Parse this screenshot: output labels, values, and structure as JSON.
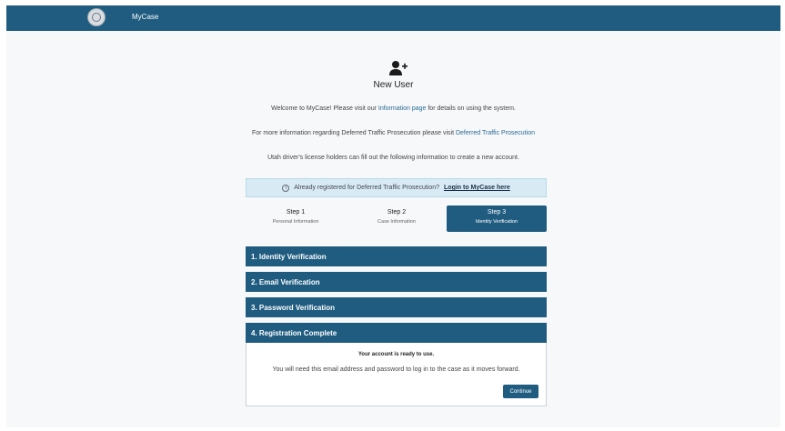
{
  "header": {
    "app_name": "MyCase",
    "seal_icon": "state-seal-icon"
  },
  "page": {
    "icon": "add-user-icon",
    "title": "New User",
    "welcome": {
      "before": "Welcome to MyCase! Please visit our ",
      "link": "Information page",
      "after": " for details on using the system."
    },
    "dtp": {
      "before": "For more information regarding Deferred Traffic Prosecution please visit ",
      "link": "Deferred Traffic Prosecution"
    },
    "instructions": "Utah driver's license holders can fill out the following information to create a new account."
  },
  "notice": {
    "icon": "info-icon",
    "text": "Already registered for Deferred Traffic Prosecution?",
    "link": "Login to MyCase here"
  },
  "steps": [
    {
      "name": "Step 1",
      "sub": "Personal Information",
      "active": false
    },
    {
      "name": "Step 2",
      "sub": "Case Information",
      "active": false
    },
    {
      "name": "Step 3",
      "sub": "Identity Verification",
      "active": true
    }
  ],
  "accordion": [
    {
      "label": "1. Identity Verification"
    },
    {
      "label": "2. Email Verification"
    },
    {
      "label": "3. Password Verification"
    },
    {
      "label": "4. Registration Complete"
    }
  ],
  "complete_panel": {
    "ready_text": "Your account is ready to use.",
    "message": "You will need this email address and password to log in to the case as it moves forward.",
    "continue_label": "Continue"
  },
  "colors": {
    "primary": "#1f5c80",
    "notice_bg": "#d8ebf5",
    "page_bg": "#f6f8fa"
  }
}
